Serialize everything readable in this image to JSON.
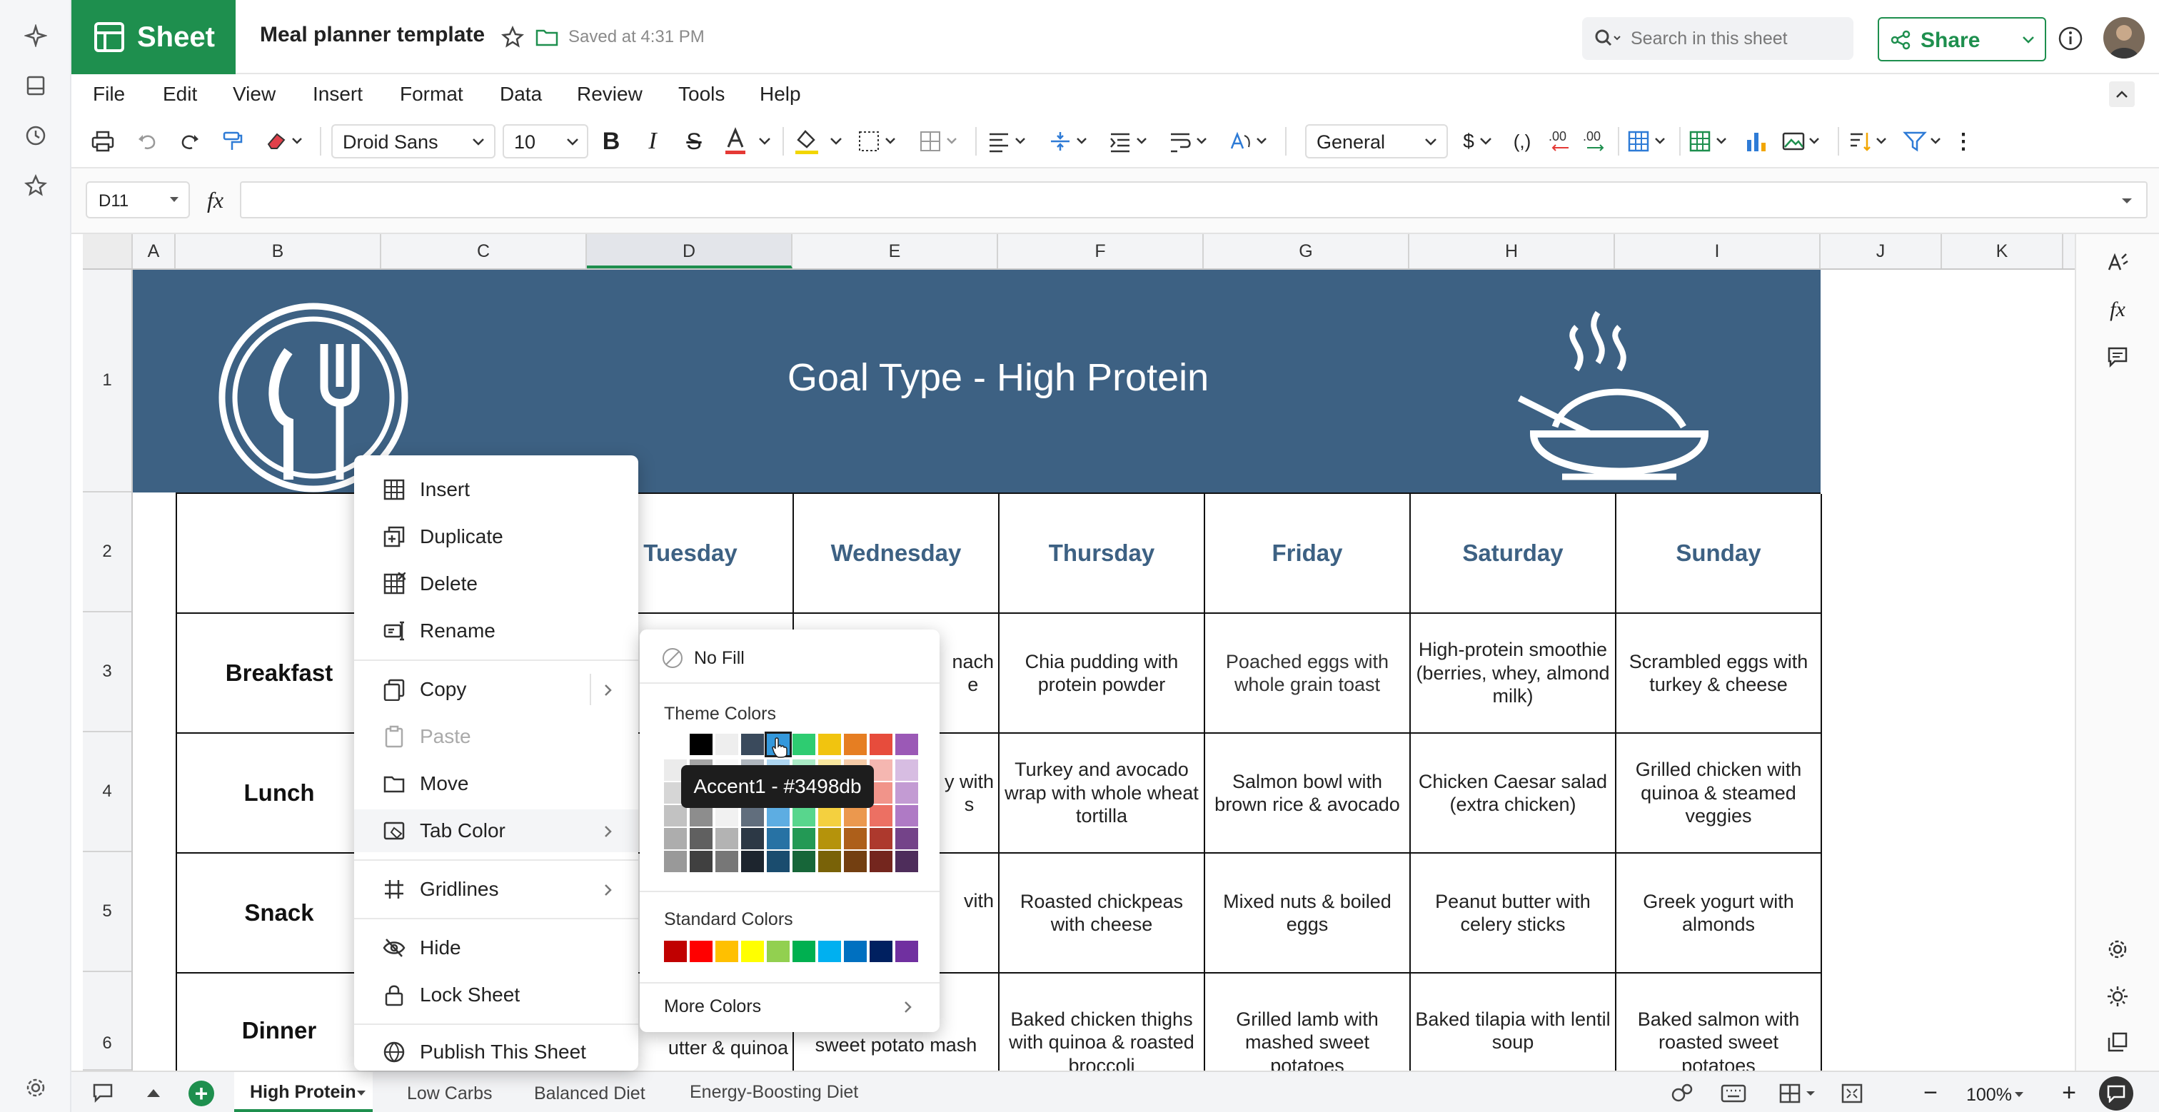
{
  "app": {
    "name": "Sheet",
    "doc_title": "Meal planner template",
    "saved_status": "Saved at 4:31 PM"
  },
  "search": {
    "placeholder": "Search in this sheet"
  },
  "share": {
    "label": "Share"
  },
  "menu": [
    "File",
    "Edit",
    "View",
    "Insert",
    "Format",
    "Data",
    "Review",
    "Tools",
    "Help"
  ],
  "toolbar": {
    "font": "Droid Sans",
    "size": "10",
    "number_format": "General"
  },
  "formula": {
    "cell_ref": "D11",
    "fx": "fx"
  },
  "columns": [
    "A",
    "B",
    "C",
    "D",
    "E",
    "F",
    "G",
    "H",
    "I",
    "J",
    "K"
  ],
  "rows": [
    "1",
    "2",
    "3",
    "4",
    "5",
    "6"
  ],
  "banner_title": "Goal Type - High Protein",
  "days": [
    "Tuesday",
    "Wednesday",
    "Thursday",
    "Friday",
    "Saturday",
    "Sunday"
  ],
  "meals": [
    "Breakfast",
    "Lunch",
    "Snack",
    "Dinner"
  ],
  "visible_fragments": {
    "e3": "nach\ne",
    "e4": "y with\ns",
    "e5": "vith",
    "d6": "utter & quinoa",
    "e6": "with\nsweet potato mash"
  },
  "grid": {
    "thursday": [
      "Chia pudding with protein powder",
      "Turkey and avocado wrap with whole wheat tortilla",
      "Roasted chickpeas with cheese",
      "Baked chicken thighs with quinoa & roasted broccoli"
    ],
    "friday": [
      "Poached eggs with whole grain toast",
      "Salmon bowl with brown rice & avocado",
      "Mixed nuts & boiled eggs",
      "Grilled lamb with mashed sweet potatoes"
    ],
    "saturday": [
      "High-protein smoothie (berries, whey, almond milk)",
      "Chicken Caesar salad (extra chicken)",
      "Peanut butter with celery sticks",
      "Baked tilapia with lentil soup"
    ],
    "sunday": [
      "Scrambled eggs with turkey & cheese",
      "Grilled chicken with quinoa & steamed veggies",
      "Greek yogurt with almonds",
      "Baked salmon with roasted sweet potatoes"
    ]
  },
  "context_menu": [
    "Insert",
    "Duplicate",
    "Delete",
    "Rename",
    "Copy",
    "Paste",
    "Move",
    "Tab Color",
    "Gridlines",
    "Hide",
    "Lock Sheet",
    "Publish This Sheet"
  ],
  "color_picker": {
    "no_fill": "No Fill",
    "theme_label": "Theme Colors",
    "standard_label": "Standard Colors",
    "more": "More Colors",
    "tooltip": "Accent1 - #3498db",
    "theme_top": [
      "#ffffff",
      "#000000",
      "#eeeeee",
      "#3a4a5c",
      "#3498db",
      "#2ecc71",
      "#f1c40f",
      "#e67e22",
      "#e74c3c",
      "#9b59b6"
    ],
    "standard": [
      "#c00000",
      "#ff0000",
      "#ffc000",
      "#ffff00",
      "#92d050",
      "#00b050",
      "#00b0f0",
      "#0070c0",
      "#002060",
      "#7030a0"
    ]
  },
  "sheet_tabs": [
    "High Protein",
    "Low Carbs",
    "Balanced Diet",
    "Energy-Boosting Diet"
  ],
  "zoom": "100%",
  "colors": {
    "brand": "#1e8f4e",
    "banner": "#3d6183",
    "accent": "#3498db"
  }
}
